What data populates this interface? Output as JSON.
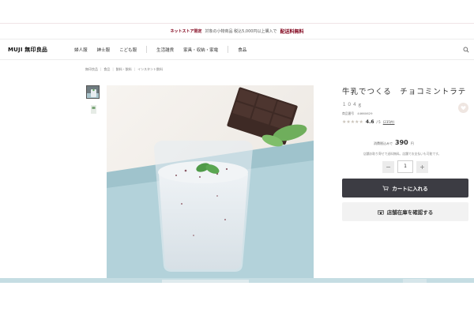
{
  "promo": {
    "tag": "ネットストア限定",
    "text": "対象の小物商品 税込5,000円以上購入で",
    "free": "配送料無料"
  },
  "header": {
    "logo": "MUJI 無印良品",
    "nav": [
      "婦人服",
      "紳士服",
      "こども服",
      "生活雑貨",
      "家具・収納・家電",
      "食品"
    ],
    "search_icon": "search-icon"
  },
  "breadcrumb": [
    "無印良品",
    "食品",
    "飲料・飲料",
    "インスタント飲料"
  ],
  "product": {
    "title": "牛乳でつくる　チョコミントラテ",
    "weight": "１０４ｇ",
    "code_label": "商品番号",
    "code": "44660629",
    "stars": 4.6,
    "score": "4.6",
    "score_suffix": "/ 5",
    "reviews": "(235件)",
    "price_label": "消費税込みで",
    "price": "390",
    "yen": "円",
    "note": "店舗お取り寄せで送料無料。店舗でお支払いも可能です。",
    "quantity": "1",
    "cart_label": "カートに入れる",
    "stock_label": "店舗在庫を確認する"
  },
  "colors": {
    "accent": "#7f0019",
    "dark_button": "#3c3c43",
    "light_button": "#f2f2f2"
  }
}
